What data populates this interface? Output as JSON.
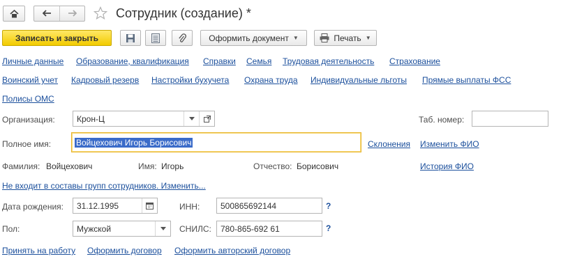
{
  "window": {
    "title": "Сотрудник (создание) *"
  },
  "toolbar": {
    "save_close_label": "Записать и закрыть",
    "create_document_label": "Оформить документ",
    "print_label": "Печать"
  },
  "tabs_row1": [
    "Личные данные",
    "Образование, квалификация",
    "Справки",
    "Семья",
    "Трудовая деятельность",
    "Страхование"
  ],
  "tabs_row2": [
    "Воинский учет",
    "Кадровый резерв",
    "Настройки бухучета",
    "Охрана труда",
    "Индивидуальные льготы",
    "Прямые выплаты ФСС"
  ],
  "tabs_row3": [
    "Полисы ОМС"
  ],
  "form": {
    "organization_label": "Организация:",
    "organization_value": "Крон-Ц",
    "tab_number_label": "Таб. номер:",
    "tab_number_value": "",
    "full_name_label": "Полное имя:",
    "full_name_value": "Войцехович Игорь Борисович",
    "declensions_link": "Склонения",
    "change_fio_link": "Изменить ФИО",
    "surname_label": "Фамилия:",
    "surname_value": "Войцехович",
    "name_label": "Имя:",
    "name_value": "Игорь",
    "patronymic_label": "Отчество:",
    "patronymic_value": "Борисович",
    "fio_history_link": "История ФИО",
    "groups_link": "Не входит в составы групп сотрудников. Изменить...",
    "birth_date_label": "Дата рождения:",
    "birth_date_value": "31.12.1995",
    "inn_label": "ИНН:",
    "inn_value": "500865692144",
    "gender_label": "Пол:",
    "gender_value": "Мужской",
    "snils_label": "СНИЛС:",
    "snils_value": "780-865-692 61",
    "help_mark": "?"
  },
  "bottom_links": [
    "Принять на работу",
    "Оформить договор",
    "Оформить авторский договор"
  ],
  "colors": {
    "accent": "#f2cb00",
    "link": "#1b4f9c",
    "focus": "#e8b52c",
    "selection": "#3a6bc9"
  },
  "icons": [
    "home-icon",
    "back-icon",
    "forward-icon",
    "star-icon",
    "save-icon",
    "list-icon",
    "attach-icon",
    "printer-icon",
    "open-icon",
    "calendar-icon",
    "dropdown-icon"
  ]
}
